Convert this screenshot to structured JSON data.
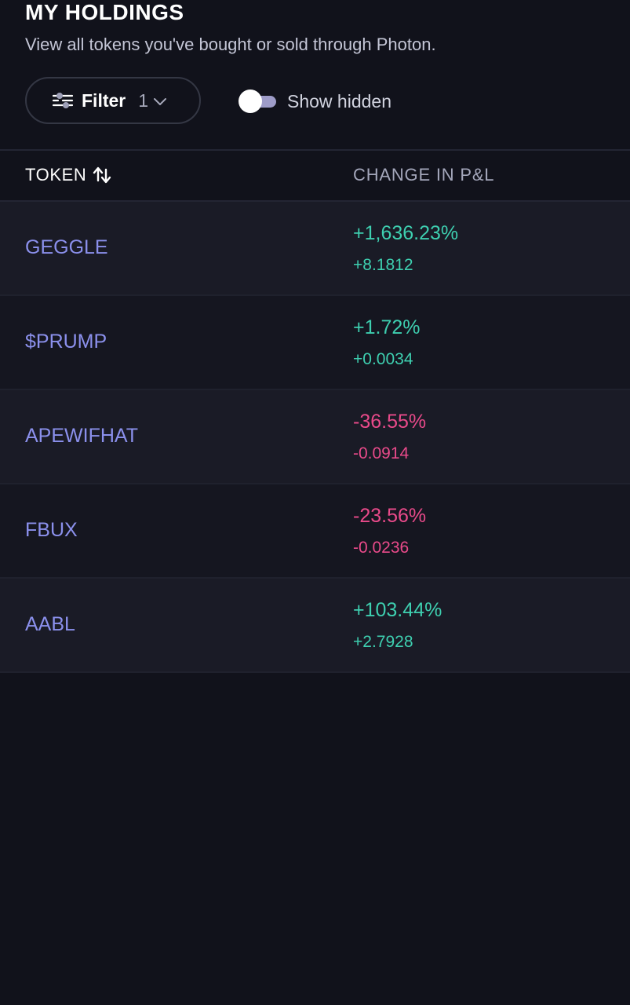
{
  "header": {
    "title": "MY HOLDINGS",
    "subtitle": "View all tokens you've bought or sold through Photon."
  },
  "filter": {
    "label": "Filter",
    "count": "1",
    "icon": "sliders-icon"
  },
  "toggle": {
    "label": "Show hidden",
    "on": false
  },
  "table": {
    "columns": {
      "token": "TOKEN",
      "change": "CHANGE IN P&L"
    },
    "rows": [
      {
        "token": "GEGGLE",
        "pct": "+1,636.23%",
        "amount": "+8.1812",
        "direction": "positive"
      },
      {
        "token": "$PRUMP",
        "pct": "+1.72%",
        "amount": "+0.0034",
        "direction": "positive"
      },
      {
        "token": "APEWIFHAT",
        "pct": "-36.55%",
        "amount": "-0.0914",
        "direction": "negative"
      },
      {
        "token": "FBUX",
        "pct": "-23.56%",
        "amount": "-0.0236",
        "direction": "negative"
      },
      {
        "token": "AABL",
        "pct": "+103.44%",
        "amount": "+2.7928",
        "direction": "positive"
      }
    ]
  },
  "colors": {
    "background": "#11121b",
    "positive": "#3ecfb0",
    "negative": "#e94a8a",
    "token_name": "#8b90ec"
  }
}
